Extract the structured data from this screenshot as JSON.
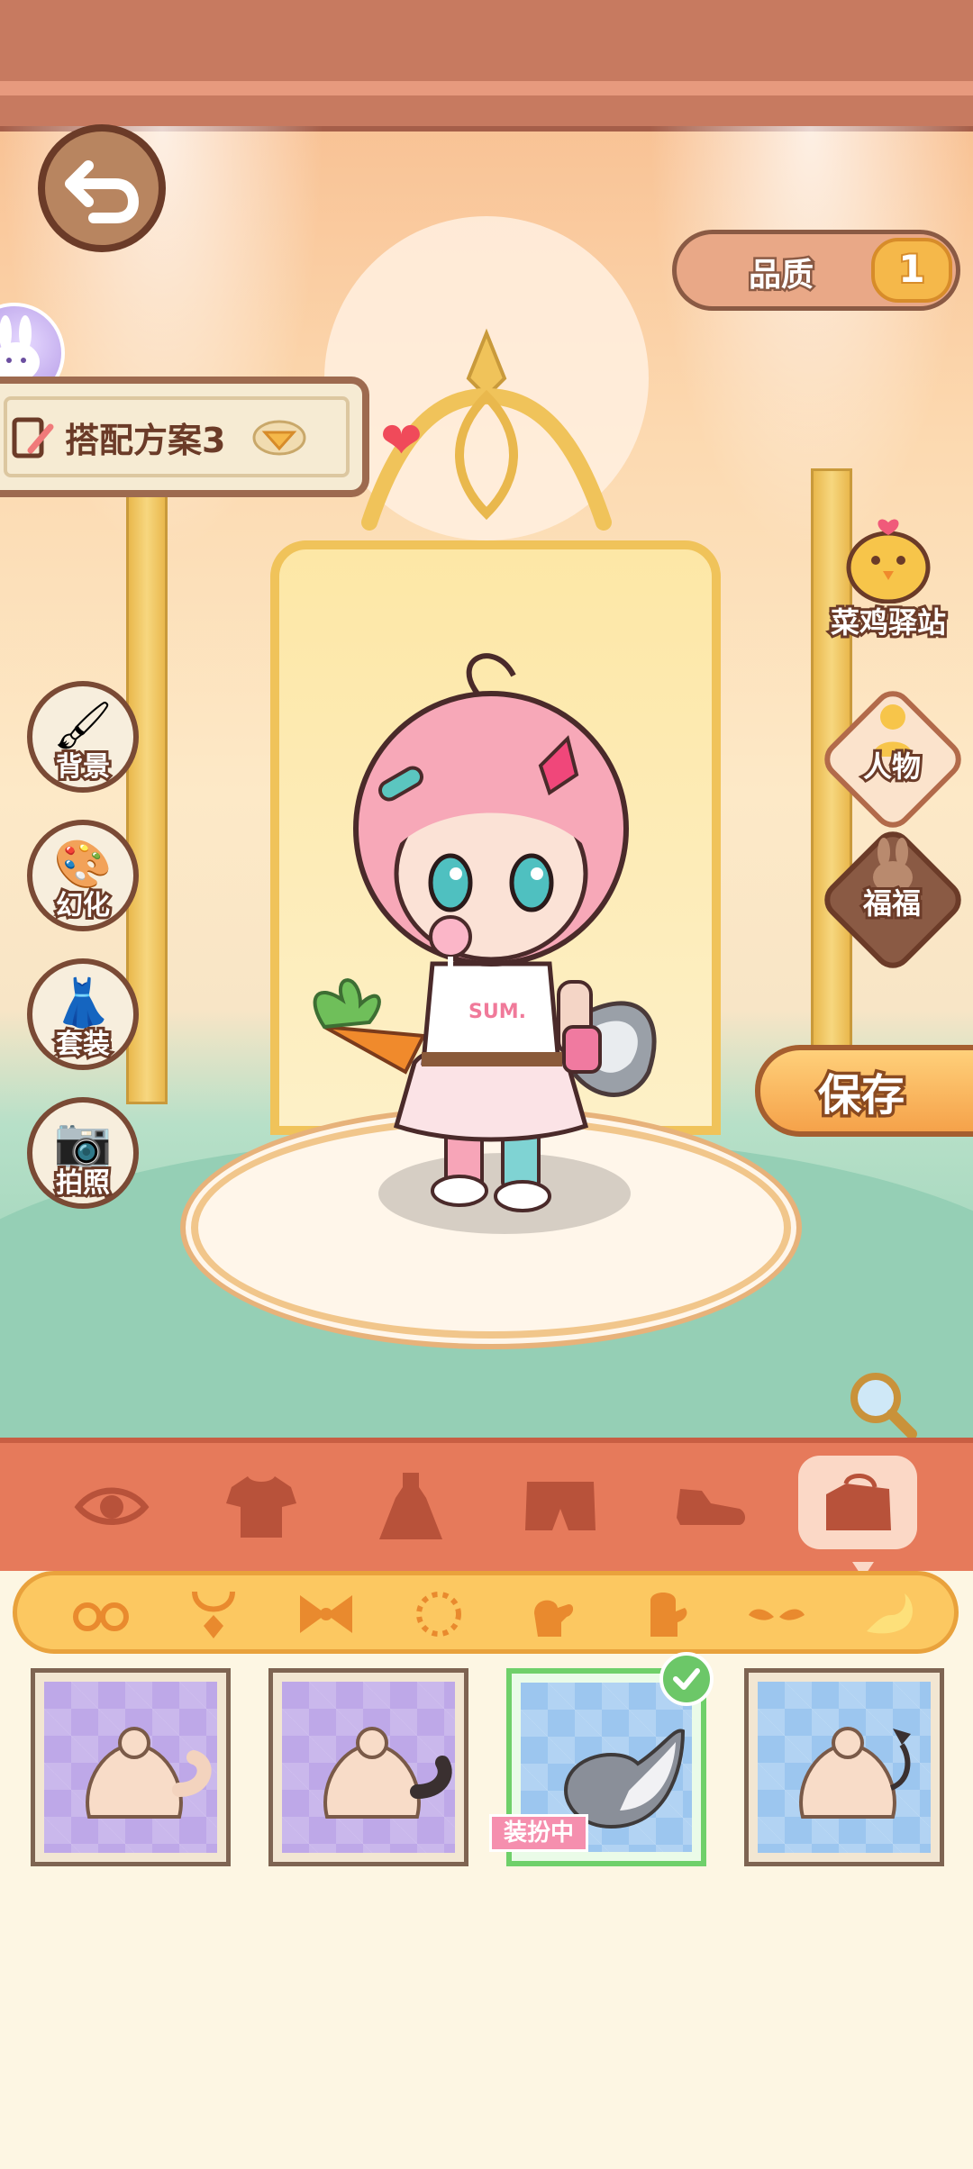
{
  "header": {
    "quality_label": "品质",
    "quality_badge": "1"
  },
  "outfit_scheme": {
    "name": "搭配方案3"
  },
  "left_menu": [
    {
      "label": "背景",
      "icon": "paint-brush-icon"
    },
    {
      "label": "幻化",
      "icon": "palette-icon"
    },
    {
      "label": "套装",
      "icon": "hanger-outfit-icon"
    },
    {
      "label": "拍照",
      "icon": "camera-icon"
    }
  ],
  "right_menu": {
    "station_label": "菜鸡驿站",
    "person_label": "人物",
    "fufu_label": "福福",
    "save_label": "保存"
  },
  "categories": [
    {
      "icon": "eye-icon",
      "active": false
    },
    {
      "icon": "shirt-icon",
      "active": false
    },
    {
      "icon": "dress-icon",
      "active": false
    },
    {
      "icon": "shorts-icon",
      "active": false
    },
    {
      "icon": "shoe-icon",
      "active": false
    },
    {
      "icon": "bag-icon",
      "active": true
    }
  ],
  "sub_categories": [
    {
      "icon": "glasses-icon"
    },
    {
      "icon": "necklace-icon"
    },
    {
      "icon": "bow-icon"
    },
    {
      "icon": "bracelet-icon"
    },
    {
      "icon": "glove-icon"
    },
    {
      "icon": "mitten-icon"
    },
    {
      "icon": "wings-icon"
    },
    {
      "icon": "tail-icon",
      "active": true
    }
  ],
  "items": [
    {
      "name": "cat-tail-item",
      "bg": "purple",
      "selected": false
    },
    {
      "name": "black-tail-item",
      "bg": "purple",
      "selected": false
    },
    {
      "name": "wolf-tail-item",
      "bg": "blue",
      "selected": true
    },
    {
      "name": "devil-tail-item",
      "bg": "blue",
      "selected": false
    }
  ],
  "equipped_label": "装扮中",
  "colors": {
    "category_bar": "#e67a5b",
    "sub_bar": "#fcc861",
    "selected_border": "#6fd06a",
    "equipped_tag": "#f58fae"
  }
}
